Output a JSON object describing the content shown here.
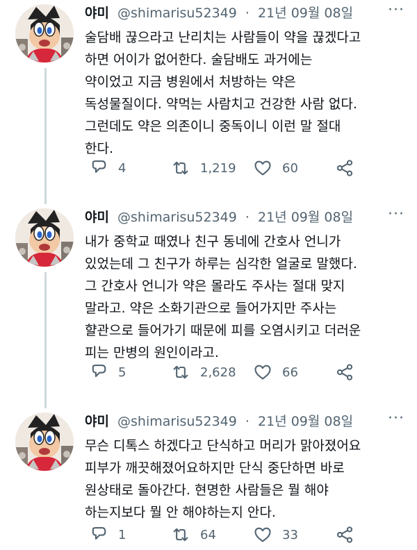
{
  "tweets": [
    {
      "name": "야미",
      "handle": "@shimarisu52349",
      "sep": "·",
      "date": "21년 09월 08일",
      "more": "···",
      "text": "술담배 끊으라고 난리치는 사람들이 약을 끊겠다고\n하면 어이가 없어한다. 술담배도 과거에는\n약이었고 지금 병원에서 처방하는 약은\n독성물질이다. 약먹는 사람치고 건강한 사람 없다.\n그런데도 약은 의존이니 중독이니 이런 말 절대\n한다.",
      "replies": "4",
      "retweets": "1,219",
      "likes": "60"
    },
    {
      "name": "야미",
      "handle": "@shimarisu52349",
      "sep": "·",
      "date": "21년 09월 08일",
      "more": "···",
      "text": "내가 중학교 때였나 친구 동네에 간호사 언니가\n있었는데 그 친구가 하루는 심각한 얼굴로 말했다.\n그 간호사 언니가 약은 몰라도 주사는 절대 맞지\n말라고. 약은 소화기관으로 들어가지만 주사는\n햘관으로 들어가기 때문에 피를 오염시키고 더러운\n피는 만병의 원인이라고.",
      "replies": "5",
      "retweets": "2,628",
      "likes": "66"
    },
    {
      "name": "야미",
      "handle": "@shimarisu52349",
      "sep": "·",
      "date": "21년 09월 08일",
      "more": "···",
      "text": "무슨 디톡스 하겠다고 단식하고 머리가 맑아졌어요\n피부가 깨끗해졌어요하지만 단식 중단하면 바로\n원상태로 돌아간다. 현명한 사람들은 뭘 해야\n하는지보다 뭘 안 해야하는지 안다.",
      "replies": "1",
      "retweets": "64",
      "likes": "33"
    }
  ],
  "icons": {
    "reply": "reply-bubble-icon",
    "retweet": "retweet-arrows-icon",
    "like": "heart-icon",
    "share": "share-nodes-icon"
  },
  "colors": {
    "text": "#0f1419",
    "muted": "#536471",
    "thread_line": "#cfd9de"
  }
}
